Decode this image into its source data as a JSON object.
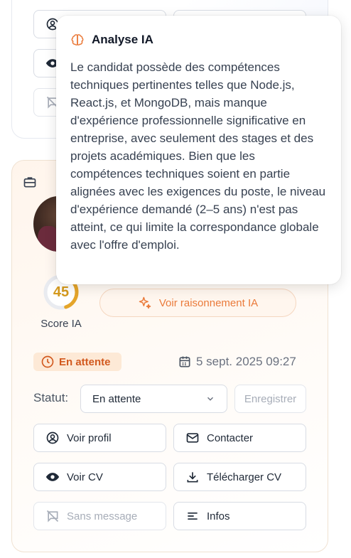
{
  "top_card": {
    "buttons": {
      "disabled_label": "Sans message"
    }
  },
  "popover": {
    "title": "Analyse IA",
    "text": "Le candidat possède des compétences techniques pertinentes telles que Node.js, React.js, et MongoDB, mais manque d'expérience professionnelle significative en entreprise, avec seulement des stages et des projets académiques. Bien que les compétences techniques soient en partie alignées avec les exigences du poste, le niveau d'expérience demandé (2–5 ans) n'est pas atteint, ce qui limite la correspondance globale avec l'offre d'emploi."
  },
  "candidate": {
    "score": {
      "value": "45",
      "percent": 45,
      "label": "Score IA",
      "color": "#e5a52a"
    },
    "reasoning_button": "Voir raisonnement IA",
    "status_badge": "En attente",
    "date": "5 sept. 2025 09:27",
    "statut_label": "Statut:",
    "statut_select": "En attente",
    "save_button": "Enregistrer",
    "actions": {
      "view_profile": "Voir profil",
      "contact": "Contacter",
      "view_cv": "Voir CV",
      "download_cv": "Télécharger CV",
      "no_message": "Sans message",
      "info": "Infos"
    }
  },
  "colors": {
    "accent": "#ea7a3a",
    "status_bg": "#fde9d6",
    "status_text": "#d2591e"
  }
}
